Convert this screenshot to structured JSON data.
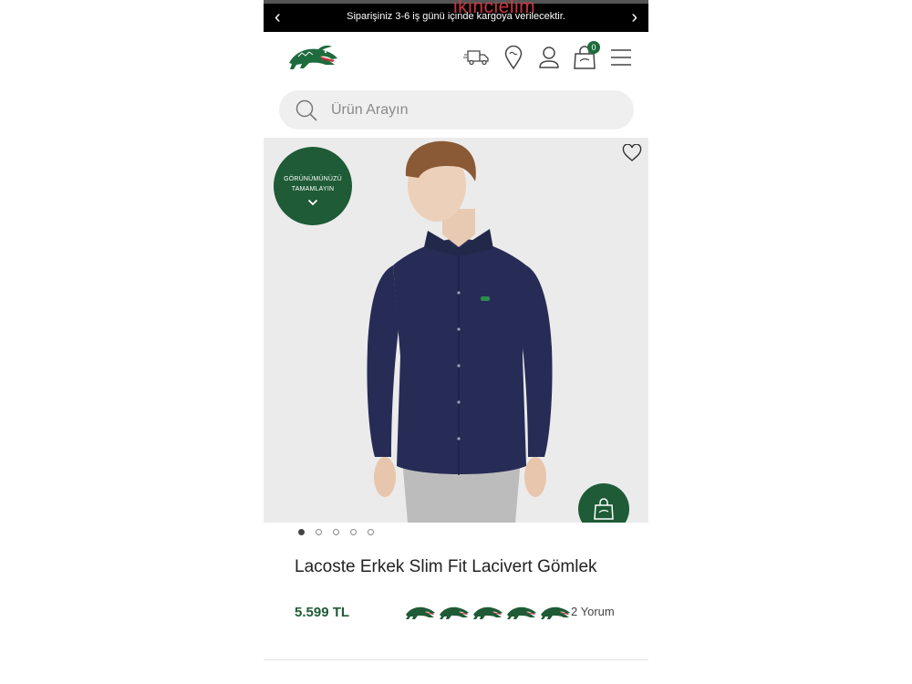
{
  "announcement": {
    "prev_label": "‹",
    "text": "Siparişiniz 3-6 iş günü içinde kargoya verilecektir.",
    "next_label": "›"
  },
  "watermark": "ikincielim",
  "header": {
    "cart_count": "0",
    "icons": [
      "shipping-truck-icon",
      "location-pin-icon",
      "user-icon",
      "shopping-bag-icon",
      "menu-icon"
    ]
  },
  "search": {
    "placeholder": "Ürün Arayın"
  },
  "product": {
    "badge_line1": "GÖRÜNÜMÜNÜZÜ",
    "badge_line2": "TAMAMLAYIN",
    "image_count": 5,
    "active_image": 1,
    "title": "Lacoste Erkek Slim Fit Lacivert Gömlek",
    "price": "5.599 TL",
    "rating_value": 5,
    "rating_max": 5,
    "reviews": "2 Yorum"
  },
  "colors": {
    "brand_green": "#1e5b36",
    "shirt_navy": "#262c55",
    "background_gray": "#ebebeb",
    "watermark_red": "#e23a44"
  }
}
